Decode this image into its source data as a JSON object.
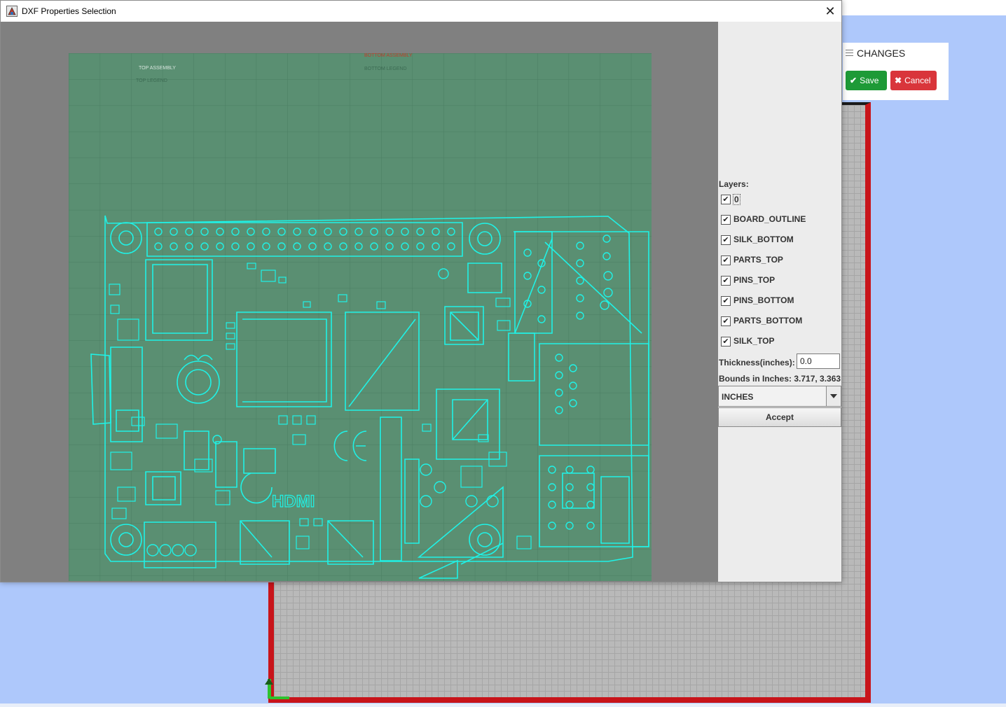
{
  "dialog": {
    "title": "DXF Properties Selection",
    "close_glyph": "✕",
    "app_icon": "dxf-app-icon"
  },
  "changes_panel": {
    "title": "CHANGES",
    "save_label": "Save",
    "cancel_label": "Cancel",
    "save_icon": "check-icon",
    "cancel_icon": "x-icon",
    "save_color": "#1e9a37",
    "cancel_color": "#d9353b"
  },
  "preview": {
    "background": "#808080",
    "board_background": "#5a8f72",
    "trace_color": "#1ff2e6",
    "labels": {
      "top_assembly": "TOP ASSEMBLY",
      "top_legend": "TOP LEGEND",
      "bottom_assembly": "BOTTOM ASSEMBLY",
      "bottom_legend": "BOTTOM LEGEND",
      "hdmi": "HDMI"
    }
  },
  "side": {
    "layers_label": "Layers:",
    "layers": [
      {
        "name": "0",
        "checked": true
      },
      {
        "name": "BOARD_OUTLINE",
        "checked": true
      },
      {
        "name": "SILK_BOTTOM",
        "checked": true
      },
      {
        "name": "PARTS_TOP",
        "checked": true
      },
      {
        "name": "PINS_TOP",
        "checked": true
      },
      {
        "name": "PINS_BOTTOM",
        "checked": true
      },
      {
        "name": "PARTS_BOTTOM",
        "checked": true
      },
      {
        "name": "SILK_TOP",
        "checked": true
      }
    ],
    "thickness_label": "Thickness(inches):",
    "thickness_value": "0.0",
    "bounds_label": "Bounds in Inches: 3.717, 3.363",
    "units_value": "INCHES",
    "accept_label": "Accept"
  }
}
